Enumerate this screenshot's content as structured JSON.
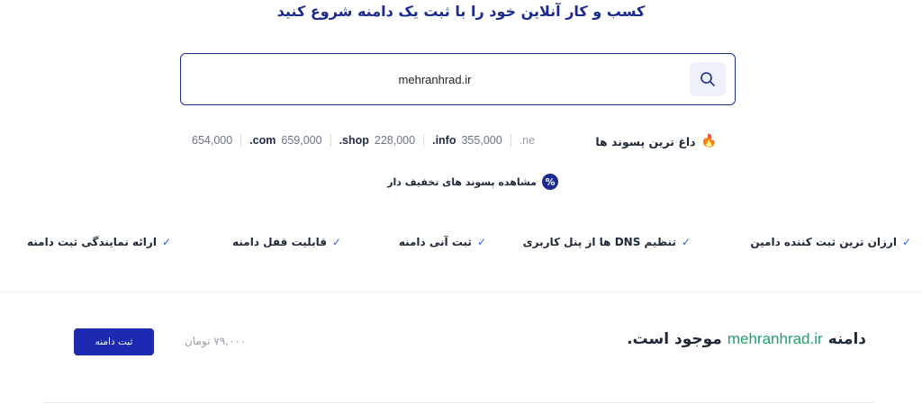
{
  "headline": "کسب و کار آنلاین خود را با ثبت یک دامنه شروع کنید",
  "search": {
    "value": "mehranhrad.ir",
    "icon": "search-icon"
  },
  "hot_tlds": {
    "label": "داغ ترین پسوند ها",
    "icon": "flame-icon",
    "items": [
      {
        "name": "",
        "price": "654,000"
      },
      {
        "name": ".com",
        "price": "659,000"
      },
      {
        "name": ".shop",
        "price": "228,000"
      },
      {
        "name": ".info",
        "price": "355,000"
      },
      {
        "name": ".ne",
        "price": ""
      }
    ]
  },
  "discount_link": {
    "label": "مشاهده پسوند های تخفیف دار",
    "icon": "percent-icon"
  },
  "features": [
    "ارزان ترین ثبت کننده دامین",
    "تنظیم DNS ها از پنل کاربری",
    "ثبت آنی دامنه",
    "قابلیت قفل دامنه",
    "ارائه نمایندگی ثبت دامنه"
  ],
  "result": {
    "prefix": "دامنه",
    "domain": "mehranhrad.ir",
    "suffix": "موجود است.",
    "price": "۷۹,۰۰۰ تومان",
    "button_label": "ثبت دامنه"
  },
  "colors": {
    "primary": "#1b2a8f",
    "available": "#22a06b",
    "check": "#2563eb",
    "flame": "#f59e0b"
  }
}
